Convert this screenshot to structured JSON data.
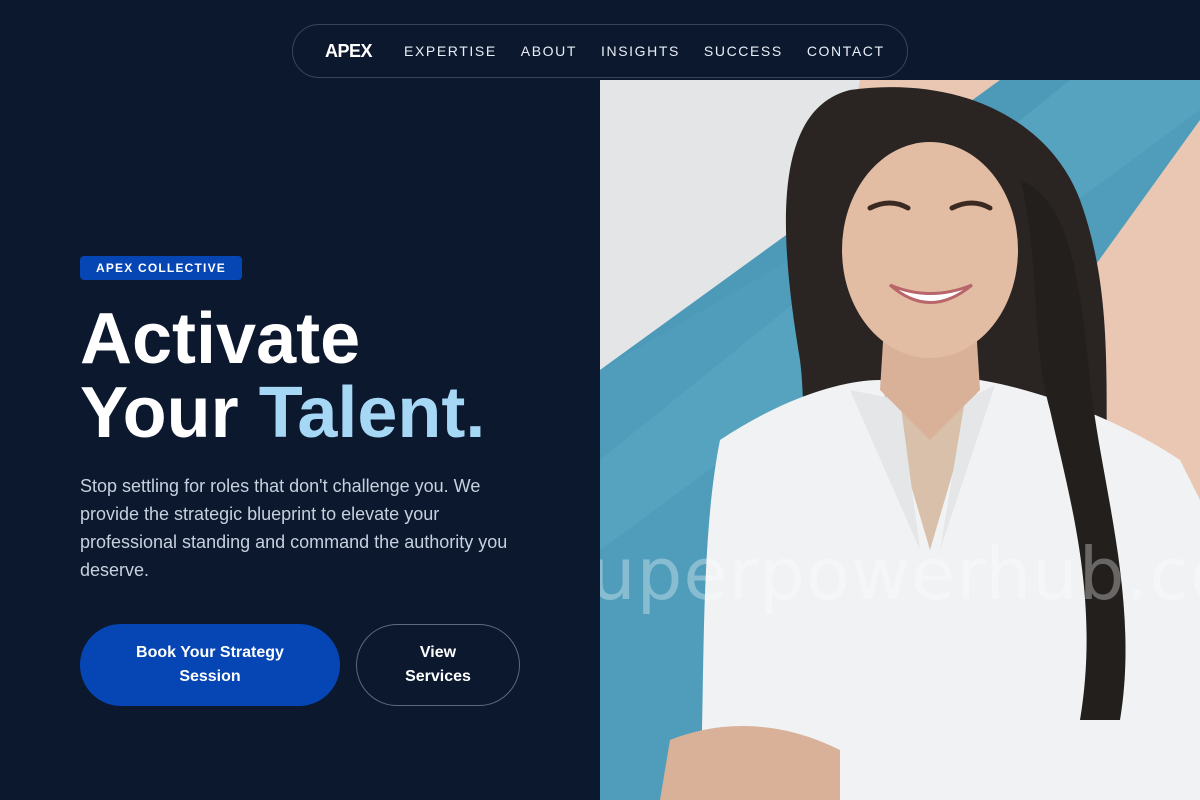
{
  "nav": {
    "logo": "APEX",
    "links": [
      "EXPERTISE",
      "ABOUT",
      "INSIGHTS",
      "SUCCESS",
      "CONTACT"
    ]
  },
  "hero": {
    "badge": "APEX COLLECTIVE",
    "headline_line1": "Activate",
    "headline_line2_plain": "Your",
    "headline_line2_accent": "Talent.",
    "description": "Stop settling for roles that don't challenge you. We provide the strategic blueprint to elevate your professional standing and command the authority you deserve.",
    "primary_button": "Book Your Strategy Session",
    "secondary_button": "View Services"
  },
  "photo": {
    "subject": "smiling woman in white shirt",
    "watermark": "uperpowerhub.co"
  },
  "colors": {
    "background": "#0b182e",
    "accent_blue": "#0646b4",
    "highlight": "#a6d8f5"
  }
}
